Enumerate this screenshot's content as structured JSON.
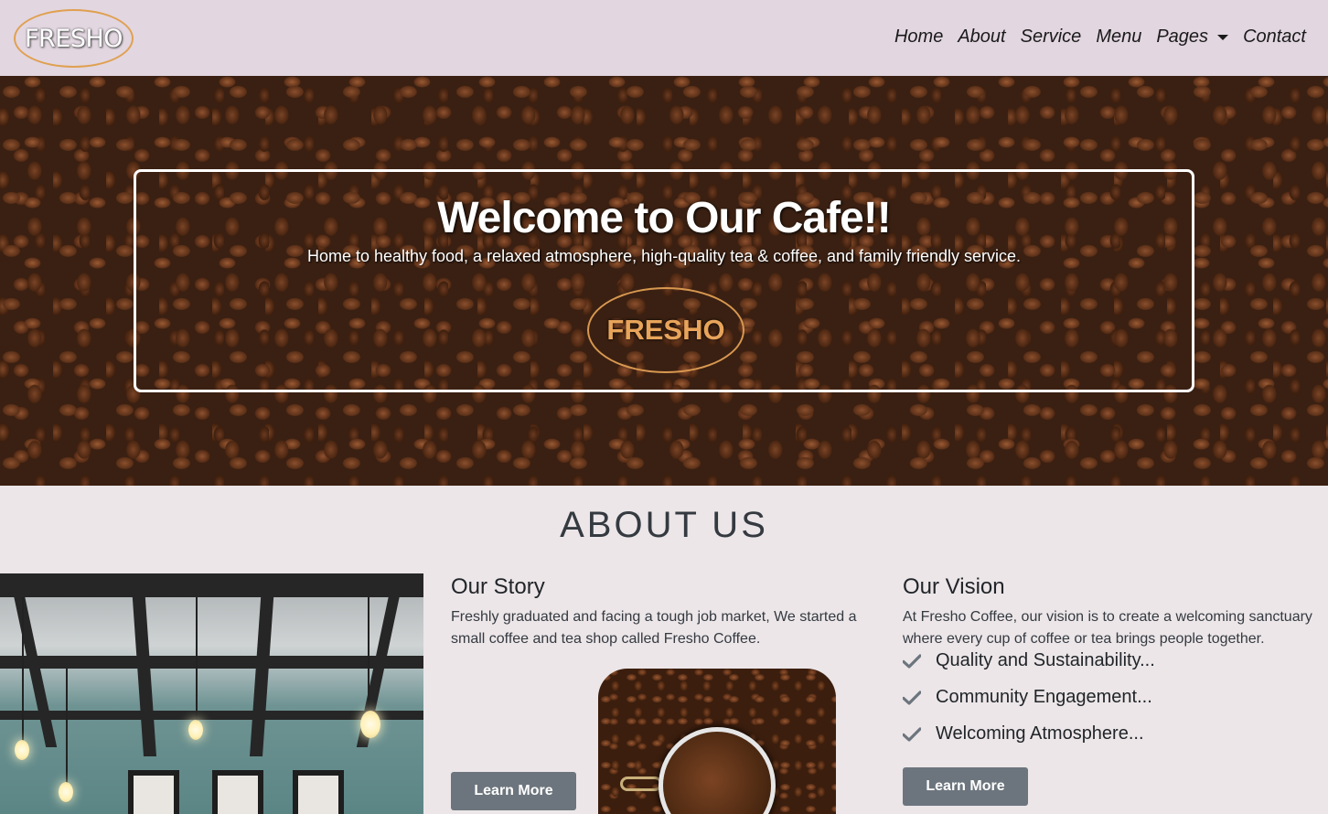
{
  "brand": {
    "logo_text": "FRESHO"
  },
  "nav": {
    "items": [
      "Home",
      "About",
      "Service",
      "Menu",
      "Pages",
      "Contact"
    ]
  },
  "hero": {
    "title": "Welcome to Our Cafe!!",
    "subtitle": "Home to healthy food, a relaxed atmosphere, high-quality tea & coffee, and family friendly service.",
    "badge": "FRESHO"
  },
  "about": {
    "heading": "ABOUT US",
    "story": {
      "title": "Our Story",
      "text": "Freshly graduated and facing a tough job market, We started a small coffee and tea shop called Fresho Coffee.",
      "button": "Learn More"
    },
    "vision": {
      "title": "Our Vision",
      "text": "At Fresho Coffee, our vision is to create a welcoming sanctuary where every cup of coffee or tea brings people together.",
      "points": [
        "Quality and Sustainability...",
        "Community Engagement...",
        "Welcoming Atmosphere..."
      ],
      "button": "Learn More"
    }
  },
  "colors": {
    "navbar_bg": "#e2d6e0",
    "page_bg": "#ece6e8",
    "accent_orange": "#e0a050",
    "button_gray": "#6c757d"
  },
  "icons": {
    "check": "check-icon",
    "dropdown": "chevron-down-icon"
  }
}
